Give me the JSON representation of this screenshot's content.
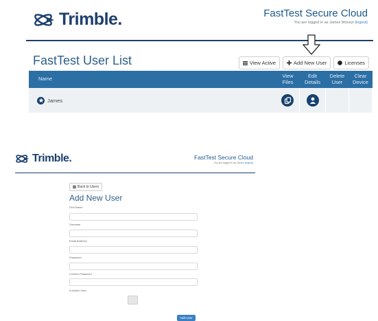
{
  "top": {
    "brand": "Trimble.",
    "app_title": "FastTest Secure Cloud",
    "logged_in_prefix": "You are logged in as James Moneyt",
    "logout": "(logout)",
    "list_title": "FastTest User List",
    "buttons": {
      "view_active": "View Active",
      "add_new_user": "Add New User",
      "licenses": "Licenses"
    },
    "table": {
      "headers": {
        "name": "Name",
        "view_files": [
          "View",
          "Files"
        ],
        "edit_details": [
          "Edit",
          "Details"
        ],
        "delete_user": [
          "Delete",
          "User"
        ],
        "clear_device": [
          "Clear",
          "Device"
        ]
      },
      "rows": [
        {
          "name": "James"
        }
      ]
    }
  },
  "bottom": {
    "brand": "Trimble.",
    "app_title": "FastTest Secure Cloud",
    "logged_in_prefix": "You are logged in as James",
    "logout": "(logout)",
    "back_button": "Back to Users",
    "form_title": "Add New User",
    "fields": {
      "first_name": "First Name",
      "surname": "Surname",
      "email": "Email Address",
      "password": "Password",
      "confirm_password": "Confirm Password",
      "is_admin": "Is Admin User"
    },
    "submit": "Add User"
  },
  "colors": {
    "brand_navy": "#1d3f6e",
    "table_header": "#2b6fa5",
    "accent_blue": "#3a7fc4"
  },
  "icons": [
    "trimble-logo-icon",
    "list-icon",
    "plus-icon",
    "license-icon",
    "down-arrow-icon",
    "user-star-icon",
    "files-icon",
    "user-icon"
  ]
}
